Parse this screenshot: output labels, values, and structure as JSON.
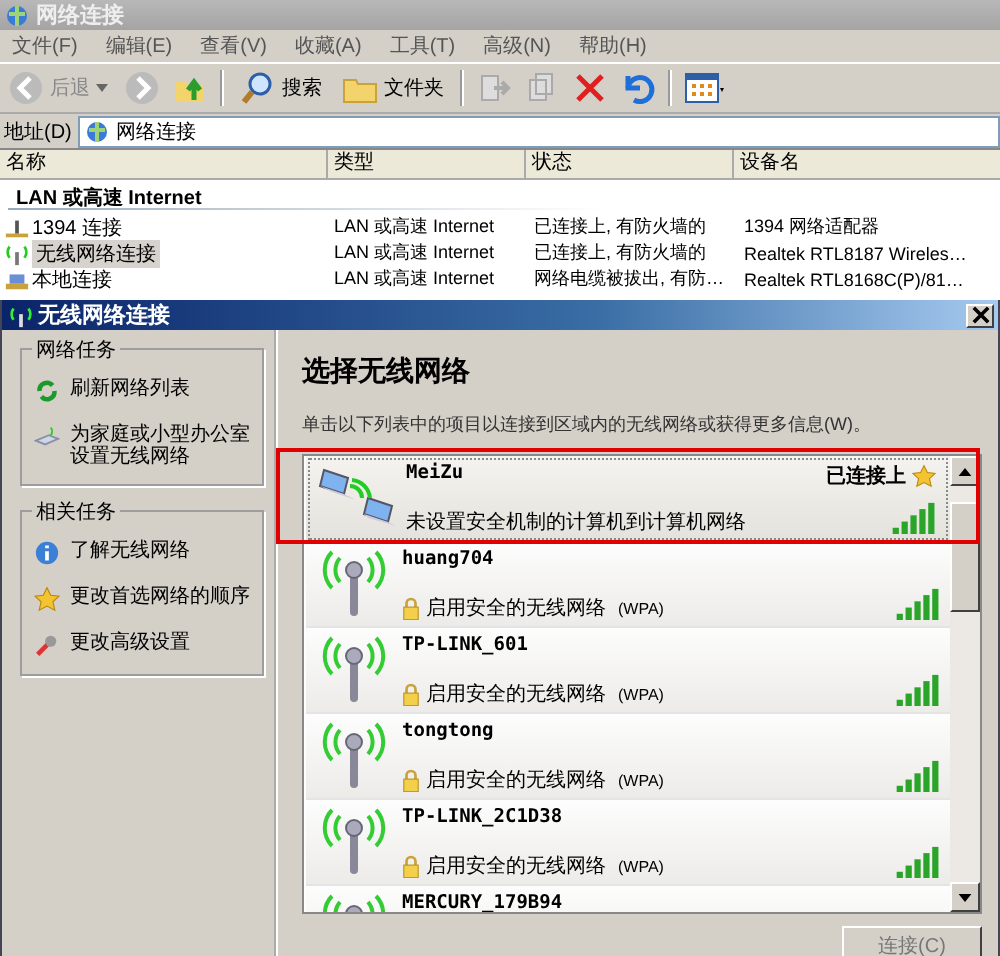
{
  "window": {
    "title": "网络连接"
  },
  "menu": [
    "文件(F)",
    "编辑(E)",
    "查看(V)",
    "收藏(A)",
    "工具(T)",
    "高级(N)",
    "帮助(H)"
  ],
  "toolbar": {
    "back": "后退",
    "search": "搜索",
    "folders": "文件夹"
  },
  "address": {
    "label": "地址(D)",
    "value": "网络连接"
  },
  "columns": [
    "名称",
    "类型",
    "状态",
    "设备名"
  ],
  "group": "LAN 或高速 Internet",
  "connections": [
    {
      "kind": "firewire",
      "name": "1394 连接",
      "type": "LAN 或高速 Internet",
      "status": "已连接上, 有防火墙的",
      "device": "1394 网络适配器",
      "selected": false
    },
    {
      "kind": "wireless",
      "name": "无线网络连接",
      "type": "LAN 或高速 Internet",
      "status": "已连接上, 有防火墙的",
      "device": "Realtek RTL8187 Wireles…",
      "selected": true
    },
    {
      "kind": "lan",
      "name": "本地连接",
      "type": "LAN 或高速 Internet",
      "status": "网络电缆被拔出, 有防…",
      "device": "Realtek RTL8168C(P)/81…",
      "selected": false
    }
  ],
  "dialog": {
    "title": "无线网络连接",
    "task_groups": [
      {
        "title": "网络任务",
        "items": [
          {
            "kind": "refresh",
            "label": "刷新网络列表"
          },
          {
            "kind": "setup",
            "label": "为家庭或小型办公室设置无线网络"
          }
        ]
      },
      {
        "title": "相关任务",
        "items": [
          {
            "kind": "info",
            "label": "了解无线网络"
          },
          {
            "kind": "star",
            "label": "更改首选网络的顺序"
          },
          {
            "kind": "tools",
            "label": "更改高级设置"
          }
        ]
      }
    ],
    "heading": "选择无线网络",
    "instruction": "单击以下列表中的项目以连接到区域内的无线网络或获得更多信息(W)。",
    "networks": [
      {
        "kind": "adhoc",
        "name": "MeiZu",
        "status": "已连接上",
        "description": "未设置安全机制的计算机到计算机网络",
        "secured": false,
        "selected": true,
        "highlighted": true
      },
      {
        "kind": "access-point",
        "name": "huang704",
        "description": "启用安全的无线网络",
        "security": "(WPA)",
        "secured": true,
        "selected": false,
        "highlighted": false
      },
      {
        "kind": "access-point",
        "name": "TP-LINK_601",
        "description": "启用安全的无线网络",
        "security": "(WPA)",
        "secured": true,
        "selected": false,
        "highlighted": false
      },
      {
        "kind": "access-point",
        "name": "tongtong",
        "description": "启用安全的无线网络",
        "security": "(WPA)",
        "secured": true,
        "selected": false,
        "highlighted": false
      },
      {
        "kind": "access-point",
        "name": "TP-LINK_2C1D38",
        "description": "启用安全的无线网络",
        "security": "(WPA)",
        "secured": true,
        "selected": false,
        "highlighted": false
      },
      {
        "kind": "access-point",
        "name": "MERCURY_179B94",
        "selected": false,
        "highlighted": false
      }
    ],
    "connect_button": "连接(C)"
  }
}
